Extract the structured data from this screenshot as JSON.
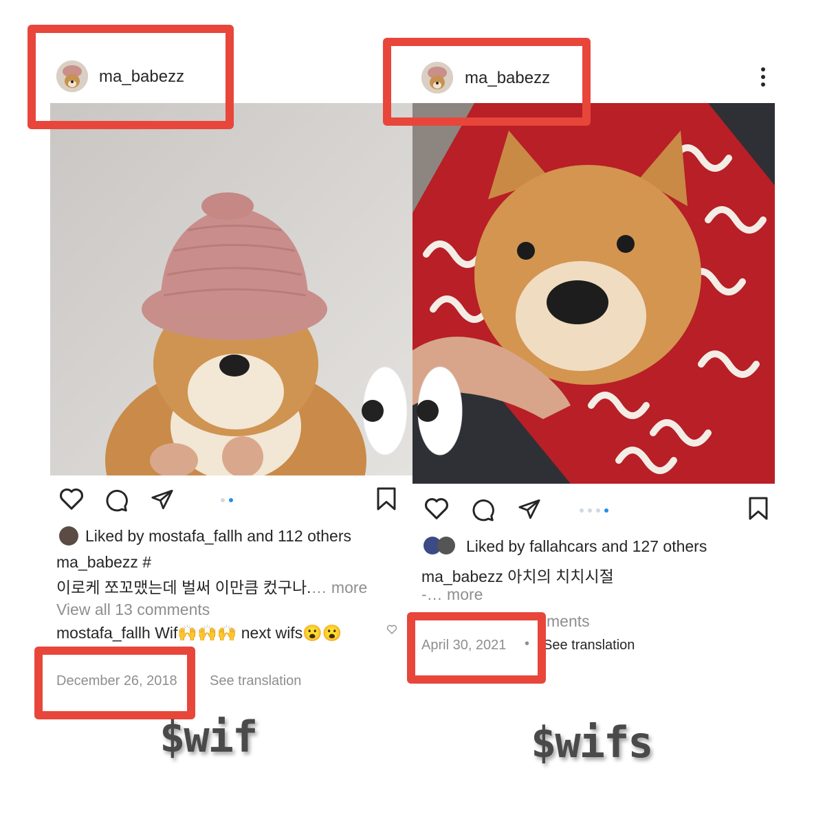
{
  "left_post": {
    "username": "ma_babezz",
    "likes_prefix": "Liked by ",
    "likes_user": "mostafa_fallh",
    "likes_suffix": " and 112 others",
    "caption_user": "ma_babezz",
    "caption_tag": " #",
    "caption_text": "이로케 쪼꼬맸는데 벌써 이만큼 컸구나.",
    "caption_more": "… more",
    "view_comments": "View all 13 comments",
    "comment_user": "mostafa_fallh",
    "comment_text": " Wif🙌🙌🙌 next wifs😮😮",
    "date": "December 26, 2018",
    "see_translation": "See translation"
  },
  "right_post": {
    "username": "ma_babezz",
    "likes_prefix": "Liked by ",
    "likes_user": "fallahcars",
    "likes_suffix": " and 127 others",
    "caption_user": "ma_babezz",
    "caption_text": " 아치의 치치시절",
    "caption_line2": "-… more",
    "view_comments_partial": "ments",
    "date": "April 30, 2021",
    "see_translation": "See translation"
  },
  "labels": {
    "left": "$wif",
    "right": "$wifs"
  },
  "colors": {
    "highlight_red": "#e8463b",
    "carousel_active": "#1f8ef1",
    "muted_text": "#8e8e8e"
  },
  "icons": [
    "heart-icon",
    "comment-icon",
    "share-icon",
    "bookmark-icon",
    "more-options-icon",
    "eyes-icon"
  ]
}
